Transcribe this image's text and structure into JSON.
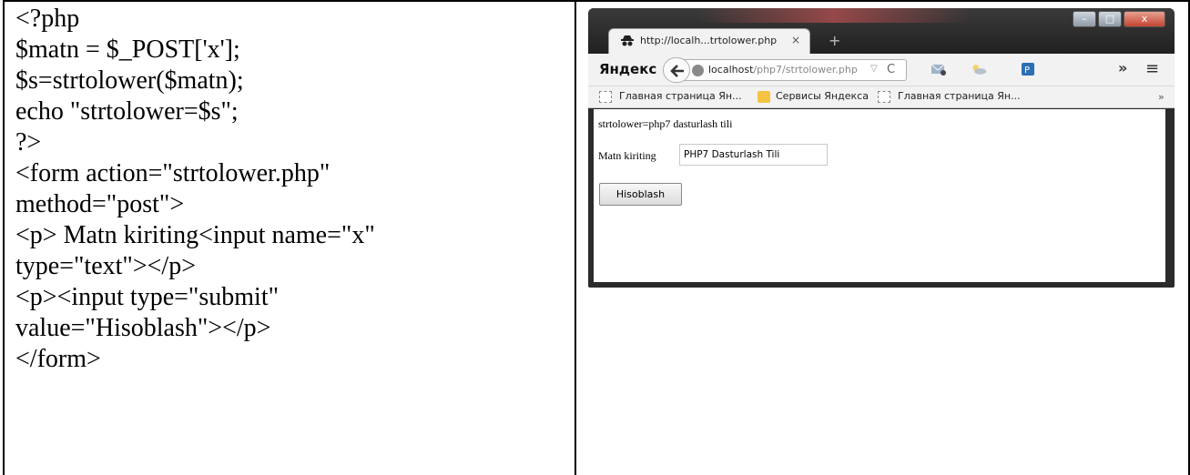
{
  "code_lines": [
    "<?php",
    "$matn = $_POST['x'];",
    "$s=strtolower($matn);",
    "echo \"strtolower=$s\";",
    "?>",
    "<form action=\"strtolower.php\"",
    "method=\"post\">",
    "<p> Matn kiriting<input name=\"x\"",
    "type=\"text\"></p>",
    "<p><input type=\"submit\"",
    "value=\"Hisoblash\"></p>",
    "</form>"
  ],
  "browser": {
    "tab_title": "http://localh...trtolower.php",
    "tab_close": "×",
    "new_tab": "+",
    "brand": "Яндекс",
    "url_host": "localhost",
    "url_path": "/php7/strtolower.php",
    "url_dropdown": "▽",
    "reload": "C",
    "overflow": "»",
    "menu": "≡",
    "bookmarks": [
      "Главная страница Ян...",
      "Сервисы Яндекса",
      "Главная страница Ян..."
    ],
    "bookmarks_overflow": "»",
    "window_buttons": [
      "–",
      "□",
      "x"
    ]
  },
  "page": {
    "output_text": "strtolower=php7 dasturlash tili",
    "input_label": "Matn kiriting",
    "input_value": "PHP7 Dasturlash Tili",
    "submit_label": "Hisoblash"
  }
}
